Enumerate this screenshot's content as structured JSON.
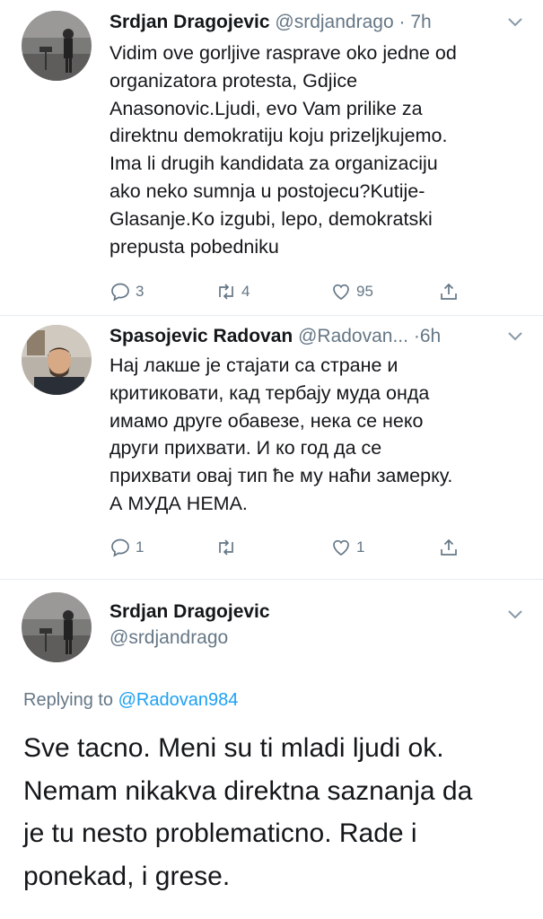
{
  "tweets": [
    {
      "author_name": "Srdjan Dragojevic",
      "handle": "@srdjandrago",
      "dot": " · ",
      "time": "7h",
      "body_lines": [
        "Vidim ove gorljive rasprave oko jedne od",
        "organizatora protesta, Gdjice",
        "Anasonovic.Ljudi, evo Vam prilike za",
        "direktnu demokratiju koju prizeljkujemo.",
        "Ima li drugih kandidata za organizaciju",
        "ako neko sumnja u postojecu?Kutije-",
        "Glasanje.Ko izgubi, lepo, demokratski",
        "prepusta pobedniku"
      ],
      "replies": "3",
      "retweets": "4",
      "likes": "95",
      "avatar_icon": "person-with-guitar-photo"
    },
    {
      "author_name": "Spasojevic Radovan",
      "handle": "@Radovan...",
      "dot": " ·",
      "time": "6h",
      "body_lines": [
        "Нај лакше је стајати са стране и",
        "критиковати, кад тербају муда онда",
        "имамо друге обавезе, нека се неко",
        "други прихвати. И ко год да се",
        "прихвати овај тип ће му наћи замерку.",
        "А МУДА НЕМА."
      ],
      "replies": "1",
      "retweets": "",
      "likes": "1",
      "avatar_icon": "bearded-man-photo"
    }
  ],
  "focused_tweet": {
    "author_name": "Srdjan Dragojevic",
    "handle": "@srdjandrago",
    "replying_prefix": "Replying to ",
    "replying_to": "@Radovan984",
    "body_lines": [
      "Sve tacno. Meni su ti mladi ljudi ok.",
      "Nemam nikakva direktna saznanja da",
      "je tu nesto problematicno. Rade i",
      "ponekad, i grese."
    ],
    "avatar_icon": "person-with-guitar-photo"
  },
  "icons": {
    "reply": "reply-icon",
    "retweet": "retweet-icon",
    "like": "heart-icon",
    "share": "share-icon",
    "menu": "chevron-down-icon"
  },
  "colors": {
    "text": "#14171a",
    "secondary": "#657786",
    "link": "#1da1f2",
    "divider": "#e6ecf0"
  }
}
